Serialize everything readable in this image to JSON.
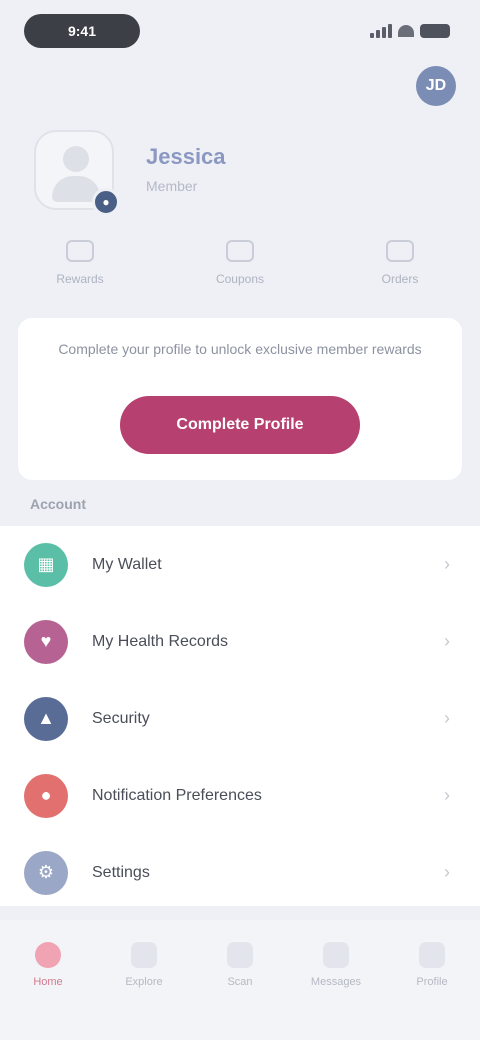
{
  "status_bar": {
    "time": "9:41"
  },
  "header": {
    "avatar_initials": "JD"
  },
  "profile": {
    "name": "Jessica",
    "subtitle": "Member",
    "badge_icon": "camera-icon"
  },
  "stats": [
    {
      "label": "Rewards",
      "icon": "gift-icon"
    },
    {
      "label": "Coupons",
      "icon": "ticket-icon"
    },
    {
      "label": "Orders",
      "icon": "bag-icon"
    }
  ],
  "promo": {
    "text": "Complete your profile to unlock exclusive member rewards",
    "button_label": "Complete Profile",
    "button_color": "#b6406f"
  },
  "section": {
    "title": "Account"
  },
  "menu": [
    {
      "label": "My Wallet",
      "icon": "wallet-icon",
      "color": "#5bbfa7"
    },
    {
      "label": "My Health Records",
      "icon": "heart-icon",
      "color": "#b66394"
    },
    {
      "label": "Security",
      "icon": "shield-icon",
      "color": "#586c96"
    },
    {
      "label": "Notification Preferences",
      "icon": "bell-icon",
      "color": "#e1706f"
    },
    {
      "label": "Settings",
      "icon": "gear-icon",
      "color": "#9ba7c6"
    }
  ],
  "tab_bar": [
    {
      "label": "Home",
      "icon": "home-icon"
    },
    {
      "label": "Explore",
      "icon": "compass-icon"
    },
    {
      "label": "Scan",
      "icon": "scan-icon"
    },
    {
      "label": "Messages",
      "icon": "chat-icon"
    },
    {
      "label": "Profile",
      "icon": "user-icon"
    }
  ]
}
